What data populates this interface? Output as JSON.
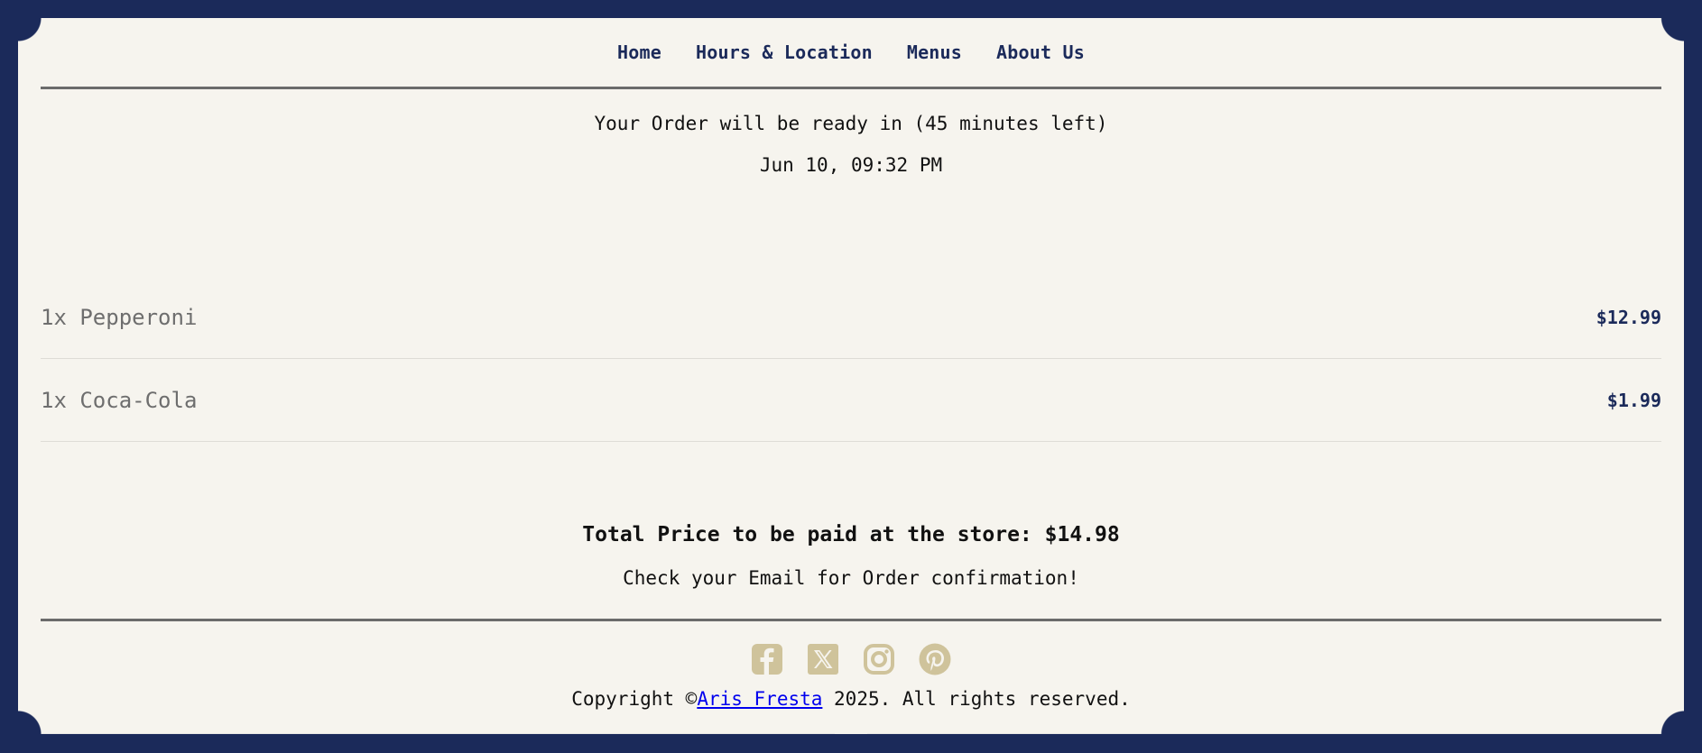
{
  "nav": {
    "items": [
      {
        "label": "Home"
      },
      {
        "label": "Hours & Location"
      },
      {
        "label": "Menus"
      },
      {
        "label": "About Us"
      }
    ]
  },
  "order": {
    "status": "Your Order will be ready in (45 minutes left)",
    "datetime": "Jun 10, 09:32 PM",
    "items": [
      {
        "name": "1x Pepperoni",
        "price": "$12.99"
      },
      {
        "name": "1x Coca-Cola",
        "price": "$1.99"
      }
    ],
    "total": "Total Price to be paid at the store: $14.98",
    "confirmation": "Check your Email for Order confirmation!"
  },
  "footer": {
    "socials": [
      "facebook-icon",
      "x-icon",
      "instagram-icon",
      "pinterest-icon"
    ],
    "copyright_prefix": "Copyright ©",
    "copyright_link": "Aris Fresta",
    "copyright_suffix": " 2025. All rights reserved."
  },
  "colors": {
    "frame": "#1b2a5a",
    "background": "#f6f4ee",
    "accent": "#1b2a5a",
    "icon": "#cfc39b"
  }
}
